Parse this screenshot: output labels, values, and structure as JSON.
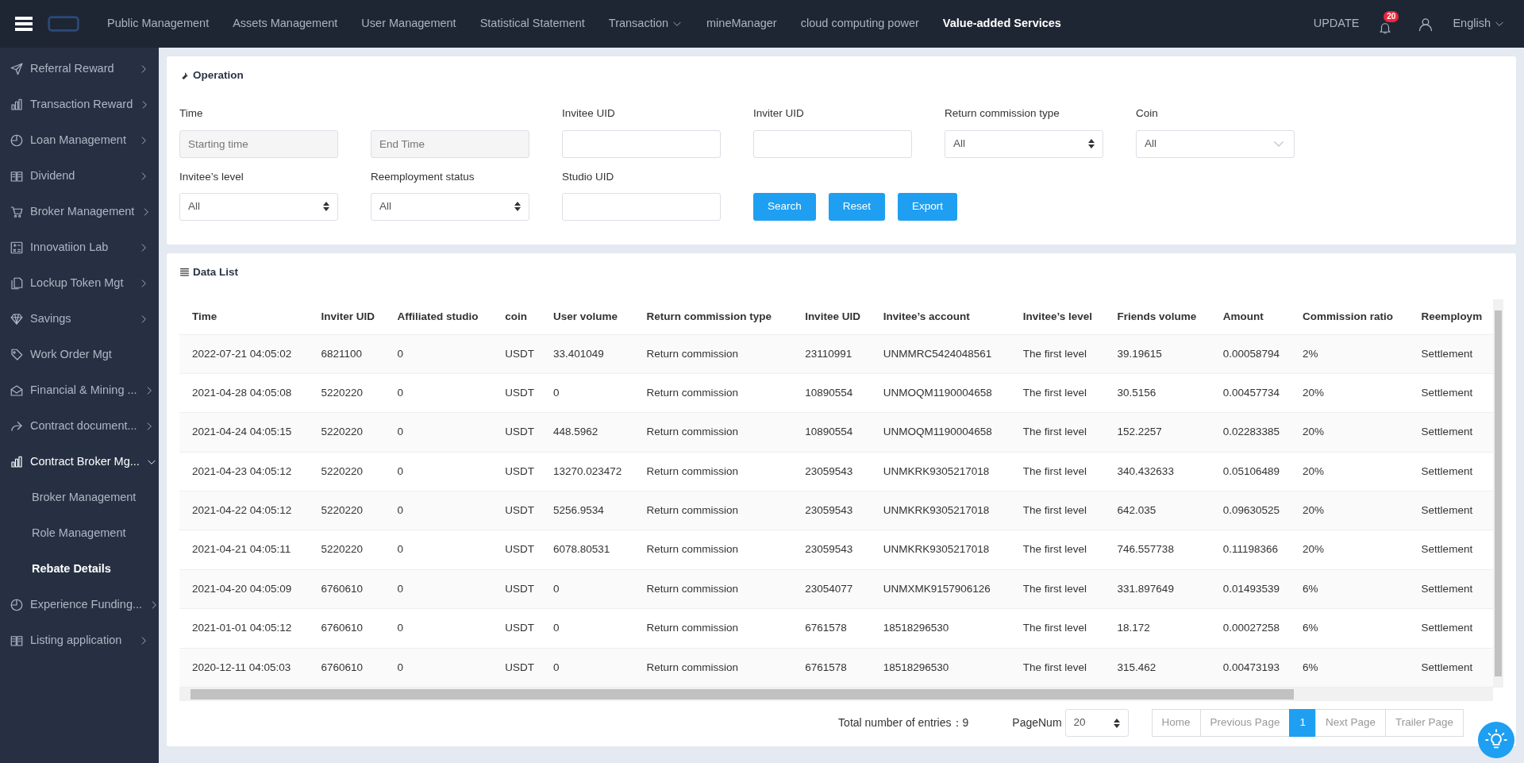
{
  "topnav": {
    "items": [
      {
        "label": "Public Management",
        "selected": false,
        "dropdown": false
      },
      {
        "label": "Assets Management",
        "selected": false,
        "dropdown": false
      },
      {
        "label": "User Management",
        "selected": false,
        "dropdown": false
      },
      {
        "label": "Statistical Statement",
        "selected": false,
        "dropdown": false
      },
      {
        "label": "Transaction",
        "selected": false,
        "dropdown": true
      },
      {
        "label": "mineManager",
        "selected": false,
        "dropdown": false
      },
      {
        "label": "cloud computing power",
        "selected": false,
        "dropdown": false
      },
      {
        "label": "Value-added Services",
        "selected": true,
        "dropdown": false
      }
    ],
    "update": "UPDATE",
    "notification_count": "20",
    "language": "English"
  },
  "sidebar": {
    "items": [
      {
        "label": "Referral Reward",
        "expandable": true,
        "expanded": false
      },
      {
        "label": "Transaction Reward",
        "expandable": true,
        "expanded": false
      },
      {
        "label": "Loan Management",
        "expandable": true,
        "expanded": false
      },
      {
        "label": "Dividend",
        "expandable": true,
        "expanded": false
      },
      {
        "label": "Broker Management",
        "expandable": true,
        "expanded": false
      },
      {
        "label": "Innovatiion Lab",
        "expandable": true,
        "expanded": false
      },
      {
        "label": "Lockup Token Mgt",
        "expandable": true,
        "expanded": false
      },
      {
        "label": "Savings",
        "expandable": true,
        "expanded": false
      },
      {
        "label": "Work Order Mgt",
        "expandable": false,
        "expanded": false
      },
      {
        "label": "Financial & Mining ...",
        "expandable": true,
        "expanded": false
      },
      {
        "label": "Contract document...",
        "expandable": true,
        "expanded": false
      },
      {
        "label": "Contract Broker Mg...",
        "expandable": true,
        "expanded": true,
        "children": [
          {
            "label": "Broker Management",
            "selected": false
          },
          {
            "label": "Role Management",
            "selected": false
          },
          {
            "label": "Rebate Details",
            "selected": true
          }
        ]
      },
      {
        "label": "Experience Funding...",
        "expandable": true,
        "expanded": false
      },
      {
        "label": "Listing application",
        "expandable": true,
        "expanded": false
      }
    ]
  },
  "operation": {
    "title": "Operation",
    "fields": [
      {
        "kind": "date",
        "label": "Time",
        "placeholder": "Starting time"
      },
      {
        "kind": "date",
        "placeholder": "End Time"
      },
      {
        "kind": "text",
        "label": "Invitee UID"
      },
      {
        "kind": "text",
        "label": "Inviter UID"
      },
      {
        "kind": "select",
        "label": "Return commission type",
        "value": "All"
      },
      {
        "kind": "combo",
        "label": "Coin",
        "value": "All"
      },
      {
        "kind": "select",
        "label": "Invitee’s level",
        "value": "All"
      },
      {
        "kind": "select",
        "label": "Reemployment status",
        "value": "All"
      },
      {
        "kind": "text",
        "label": "Studio UID"
      }
    ],
    "buttons": [
      "Search",
      "Reset",
      "Export"
    ]
  },
  "data_list": {
    "title": "Data List",
    "columns": [
      "Time",
      "Inviter UID",
      "Affiliated studio",
      "coin",
      "User volume",
      "Return commission type",
      "Invitee UID",
      "Invitee’s account",
      "Invitee’s level",
      "Friends volume",
      "Amount",
      "Commission ratio",
      "Reemploym"
    ],
    "rows": [
      [
        "2022-07-21 04:05:02",
        "6821100",
        "0",
        "USDT",
        "33.401049",
        "Return commission",
        "23110991",
        "UNMMRC5424048561",
        "The first level",
        "39.19615",
        "0.00058794",
        "2%",
        "Settlement"
      ],
      [
        "2021-04-28 04:05:08",
        "5220220",
        "0",
        "USDT",
        "0",
        "Return commission",
        "10890554",
        "UNMOQM1190004658",
        "The first level",
        "30.5156",
        "0.00457734",
        "20%",
        "Settlement"
      ],
      [
        "2021-04-24 04:05:15",
        "5220220",
        "0",
        "USDT",
        "448.5962",
        "Return commission",
        "10890554",
        "UNMOQM1190004658",
        "The first level",
        "152.2257",
        "0.02283385",
        "20%",
        "Settlement"
      ],
      [
        "2021-04-23 04:05:12",
        "5220220",
        "0",
        "USDT",
        "13270.023472",
        "Return commission",
        "23059543",
        "UNMKRK9305217018",
        "The first level",
        "340.432633",
        "0.05106489",
        "20%",
        "Settlement"
      ],
      [
        "2021-04-22 04:05:12",
        "5220220",
        "0",
        "USDT",
        "5256.9534",
        "Return commission",
        "23059543",
        "UNMKRK9305217018",
        "The first level",
        "642.035",
        "0.09630525",
        "20%",
        "Settlement"
      ],
      [
        "2021-04-21 04:05:11",
        "5220220",
        "0",
        "USDT",
        "6078.80531",
        "Return commission",
        "23059543",
        "UNMKRK9305217018",
        "The first level",
        "746.557738",
        "0.11198366",
        "20%",
        "Settlement"
      ],
      [
        "2021-04-20 04:05:09",
        "6760610",
        "0",
        "USDT",
        "0",
        "Return commission",
        "23054077",
        "UNMXMK9157906126",
        "The first level",
        "331.897649",
        "0.01493539",
        "6%",
        "Settlement"
      ],
      [
        "2021-01-01 04:05:12",
        "6760610",
        "0",
        "USDT",
        "0",
        "Return commission",
        "6761578",
        "18518296530",
        "The first level",
        "18.172",
        "0.00027258",
        "6%",
        "Settlement"
      ],
      [
        "2020-12-11 04:05:03",
        "6760610",
        "0",
        "USDT",
        "0",
        "Return commission",
        "6761578",
        "18518296530",
        "The first level",
        "315.462",
        "0.00473193",
        "6%",
        "Settlement"
      ]
    ],
    "total_label": "Total number of entries：9",
    "page_size_label": "PageNum",
    "page_size": "20",
    "pager": [
      {
        "label": "Home",
        "selected": false
      },
      {
        "label": "Previous Page",
        "selected": false
      },
      {
        "label": "1",
        "selected": true
      },
      {
        "label": "Next Page",
        "selected": false
      },
      {
        "label": "Trailer Page",
        "selected": false
      }
    ]
  }
}
